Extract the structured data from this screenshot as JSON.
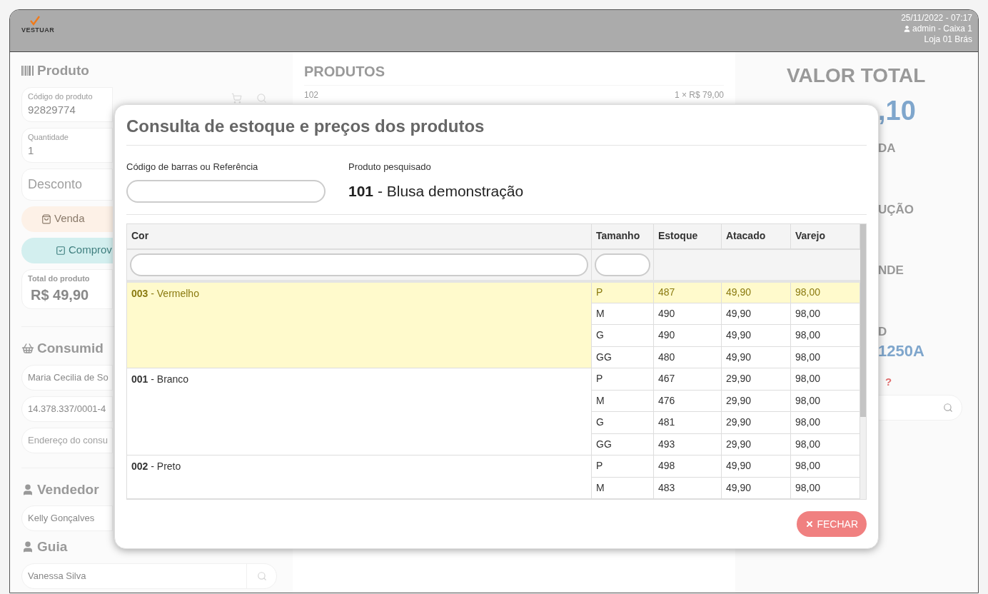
{
  "header": {
    "logo": "VESTUAR",
    "datetime": "25/11/2022 - 07:17",
    "user": "admin - Caixa 1",
    "store": "Loja 01 Brás"
  },
  "left_panel": {
    "product_heading": "Produto",
    "product_code": {
      "label": "Código do produto",
      "value": "92829774"
    },
    "quantity": {
      "label": "Quantidade",
      "value": "1"
    },
    "discount": {
      "placeholder": "Desconto"
    },
    "sale_tab": {
      "label": "Venda",
      "selected": true
    },
    "receipt_button": "Comprov",
    "product_total": {
      "label": "Total do produto",
      "value": "R$ 49,90"
    },
    "consumer_heading": "Consumid",
    "consumer_fields": [
      {
        "value": "Maria Cecilia de So"
      },
      {
        "value": "14.378.337/0001-4"
      },
      {
        "placeholder": "Endereço do consu"
      }
    ],
    "seller_heading": "Vendedor",
    "seller": "Kelly Gonçalves",
    "guide_heading": "Guia",
    "guide": "Vanessa Silva"
  },
  "products_panel": {
    "title": "PRODUTOS",
    "rows": [
      {
        "code": "102",
        "price": "1 × R$ 79,00"
      }
    ]
  },
  "right_panel": {
    "total_label": "VALOR TOTAL",
    "total_value": ",10",
    "fragments": [
      "DA",
      "UÇÃO",
      "NDE",
      "D"
    ],
    "code": "1250A",
    "help": "?"
  },
  "modal": {
    "title": "Consulta de estoque e preços dos produtos",
    "search": {
      "label": "Código de barras ou Referência"
    },
    "product": {
      "label": "Produto pesquisado",
      "value": "**101** - Blusa demonstração"
    },
    "columns": [
      "Cor",
      "Tamanho",
      "Estoque",
      "Atacado",
      "Varejo"
    ],
    "colors": [
      {
        "label": "**003** - Vermelho",
        "selected": true,
        "sizes": [
          {
            "size": "P",
            "stock": "487",
            "wholesale": "49,90",
            "retail": "98,00",
            "selected": true
          },
          {
            "size": "M",
            "stock": "490",
            "wholesale": "49,90",
            "retail": "98,00",
            "selected": false
          },
          {
            "size": "G",
            "stock": "490",
            "wholesale": "49,90",
            "retail": "98,00",
            "selected": false
          },
          {
            "size": "GG",
            "stock": "480",
            "wholesale": "49,90",
            "retail": "98,00",
            "selected": false
          }
        ]
      },
      {
        "label": "**001** - Branco",
        "selected": false,
        "sizes": [
          {
            "size": "P",
            "stock": "467",
            "wholesale": "29,90",
            "retail": "98,00",
            "selected": false
          },
          {
            "size": "M",
            "stock": "476",
            "wholesale": "29,90",
            "retail": "98,00",
            "selected": false
          },
          {
            "size": "G",
            "stock": "481",
            "wholesale": "29,90",
            "retail": "98,00",
            "selected": false
          },
          {
            "size": "GG",
            "stock": "493",
            "wholesale": "29,90",
            "retail": "98,00",
            "selected": false
          }
        ]
      },
      {
        "label": "**002** - Preto",
        "selected": false,
        "sizes": [
          {
            "size": "P",
            "stock": "498",
            "wholesale": "49,90",
            "retail": "98,00",
            "selected": false
          },
          {
            "size": "M",
            "stock": "483",
            "wholesale": "49,90",
            "retail": "98,00",
            "selected": false
          }
        ]
      }
    ],
    "close_button": "FECHAR"
  }
}
